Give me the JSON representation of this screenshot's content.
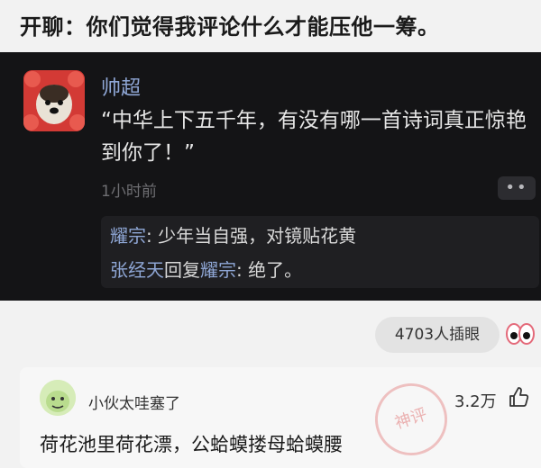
{
  "post": {
    "title": "开聊：你们觉得我评论什么才能压他一筹。"
  },
  "comment": {
    "username": "帅超",
    "text": "“中华上下五千年，有没有哪一首诗词真正惊艳到你了！”",
    "time": "1小时前",
    "more_label": "••",
    "replies": [
      {
        "name": "耀宗",
        "sep": ": ",
        "text": "少年当自强，对镜贴花黄"
      },
      {
        "name": "张经天",
        "mid": "回复",
        "target": "耀宗",
        "sep": ": ",
        "text": "绝了。"
      }
    ]
  },
  "stats": {
    "reactions": "4703人插眼"
  },
  "reply": {
    "username": "小伙太哇塞了",
    "likes": "3.2万",
    "text": "荷花池里荷花漂，公蛤蟆搂母蛤蟆腰",
    "stamp": "神评"
  },
  "colors": {
    "dark_bg": "#141416",
    "name_blue": "#8fa7d6",
    "accent_red": "#d9403b"
  }
}
